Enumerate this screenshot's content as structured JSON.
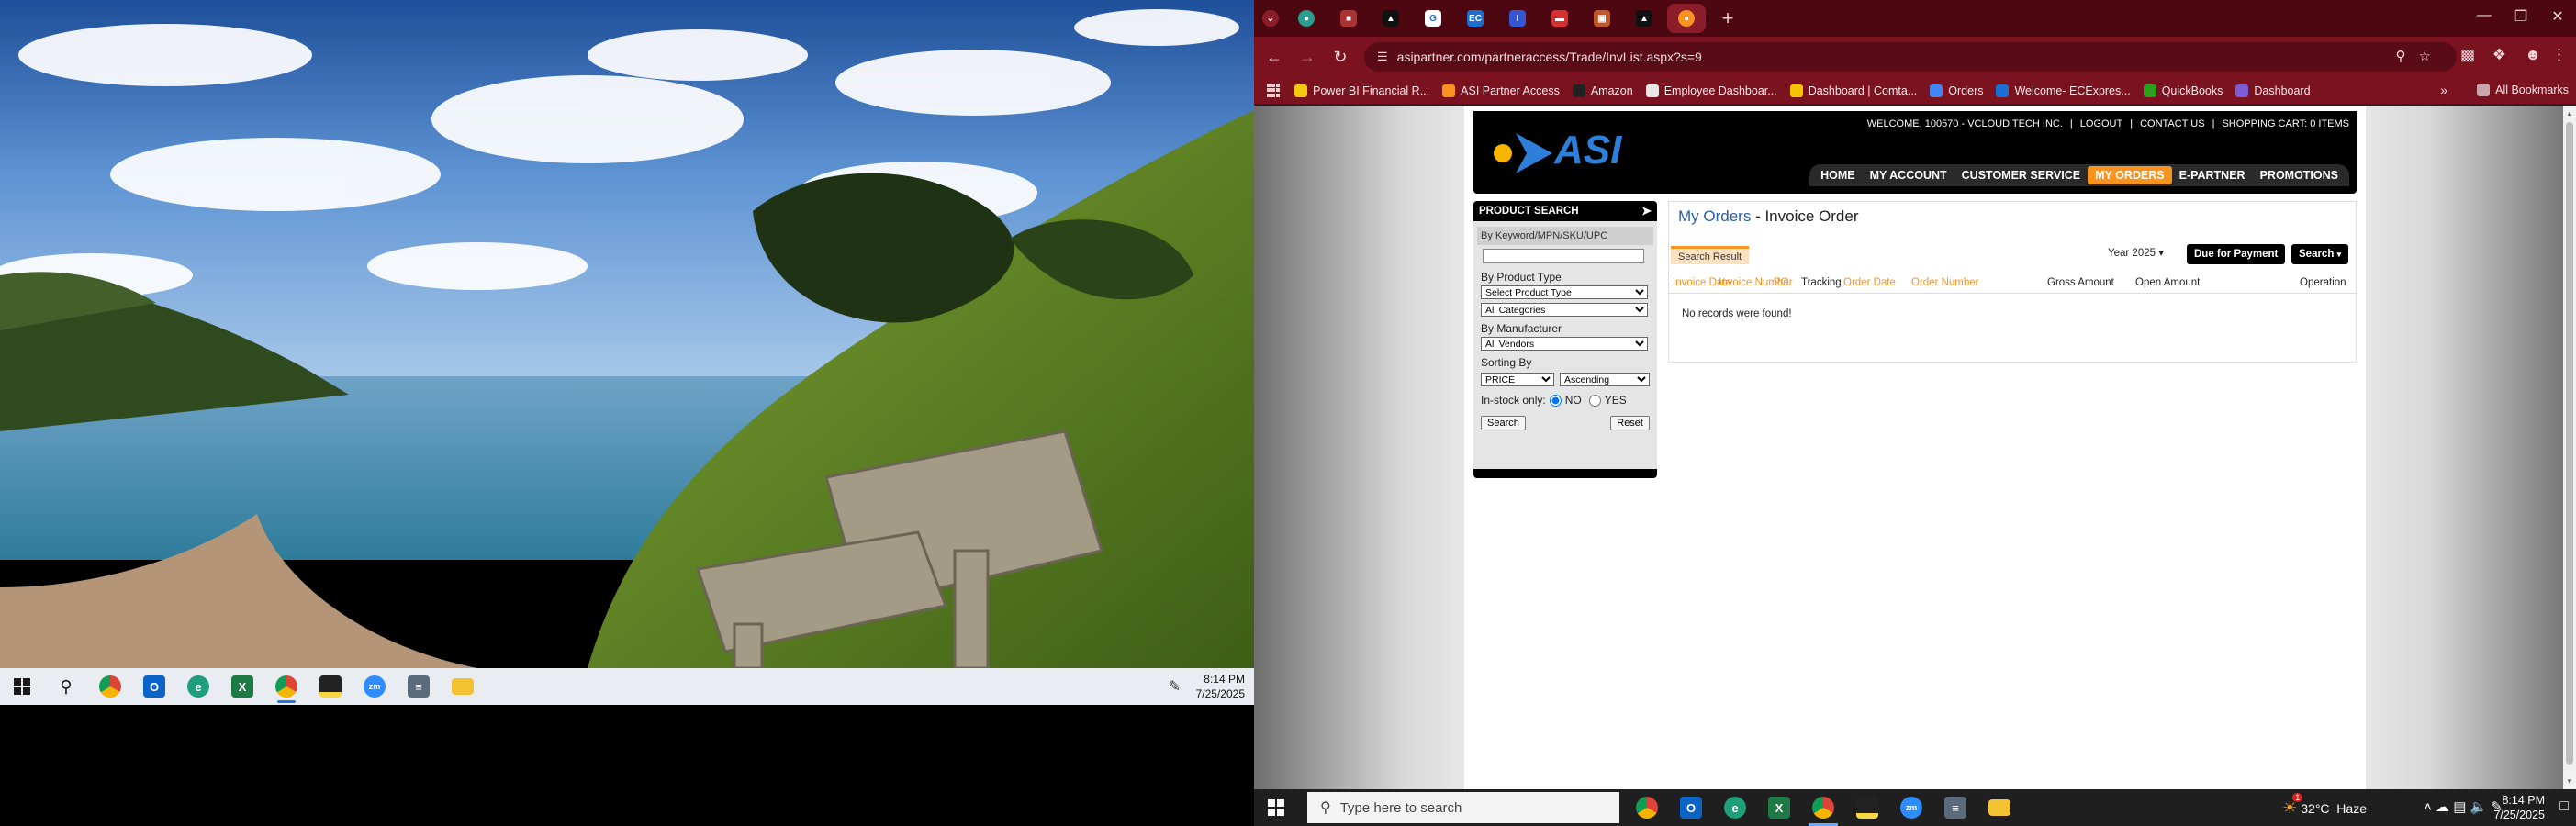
{
  "left_taskbar": {
    "time": "8:14 PM",
    "date": "7/25/2025"
  },
  "browser": {
    "url": "asipartner.com/partneraccess/Trade/InvList.aspx?s=9",
    "bookmarks": [
      {
        "label": "Power BI Financial R...",
        "color": "#f2c811"
      },
      {
        "label": "ASI Partner Access",
        "color": "#f7931e"
      },
      {
        "label": "Amazon",
        "color": "#222222"
      },
      {
        "label": "Employee Dashboar...",
        "color": "#e8e8e8"
      },
      {
        "label": "Dashboard | Comta...",
        "color": "#f7c400"
      },
      {
        "label": "Orders",
        "color": "#4285f4"
      },
      {
        "label": "Welcome- ECExpres...",
        "color": "#1b6fd1"
      },
      {
        "label": "QuickBooks",
        "color": "#2ca01c"
      },
      {
        "label": "Dashboard",
        "color": "#7b5cd6"
      }
    ],
    "all_bookmarks": "All Bookmarks"
  },
  "site": {
    "logo_text": "ASI",
    "topbar": [
      "WELCOME, 100570 - VCLOUD TECH INC.",
      "|",
      "LOGOUT",
      "|",
      "CONTACT US",
      "|",
      "SHOPPING CART: 0 ITEMS"
    ],
    "nav": [
      "HOME",
      "MY ACCOUNT",
      "CUSTOMER SERVICE",
      "MY ORDERS",
      "E-PARTNER",
      "PROMOTIONS"
    ],
    "active_nav": "MY ORDERS"
  },
  "product_search": {
    "title": "PRODUCT SEARCH",
    "keyword_label": "By Keyword/MPN/SKU/UPC",
    "keyword_value": "",
    "product_type_label": "By Product Type",
    "product_type_selected": "Select Product Type",
    "category_selected": "All Categories",
    "manufacturer_label": "By Manufacturer",
    "vendor_selected": "All Vendors",
    "sorting_label": "Sorting By",
    "sort_field": "PRICE",
    "sort_order": "Ascending",
    "instock_label": "In-stock only:",
    "instock_no": "NO",
    "instock_yes": "YES",
    "search_btn": "Search",
    "reset_btn": "Reset"
  },
  "orders": {
    "title_link": "My Orders",
    "title_sep": " - ",
    "title_rest": "Invoice Order",
    "tab": "Search Result",
    "year": "Year 2025",
    "due_btn": "Due for Payment",
    "search_btn": "Search",
    "columns": [
      "Invoice Date",
      "Invoice Number",
      "PO",
      "Tracking",
      "Order Date",
      "Order Number",
      "Gross Amount",
      "Open Amount",
      "Operation"
    ],
    "empty_msg": "No records were found!"
  },
  "right_taskbar": {
    "search_placeholder": "Type here to search",
    "weather": "32°C  Haze",
    "weather_badge": "1",
    "time": "8:14 PM",
    "date": "7/25/2025"
  }
}
